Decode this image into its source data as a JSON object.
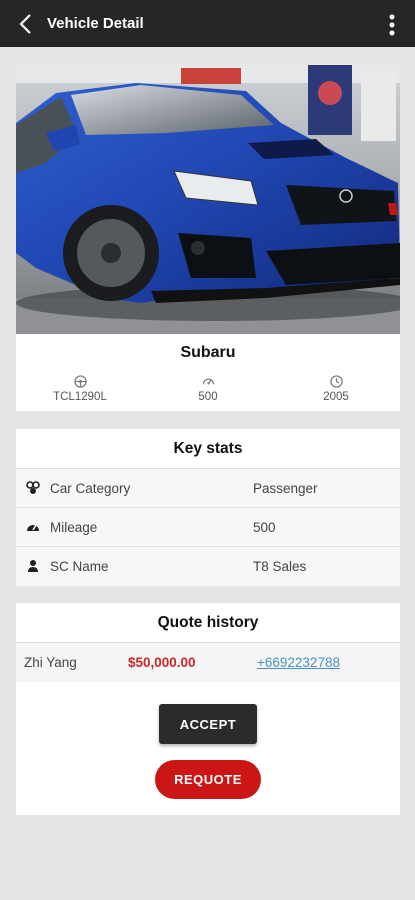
{
  "appbar": {
    "title": "Vehicle Detail"
  },
  "hero": {
    "image": "blue-subaru-photo"
  },
  "vehicle": {
    "name": "Subaru",
    "plate": "TCL1290L",
    "mileage": "500",
    "year": "2005"
  },
  "key_stats": {
    "title": "Key stats",
    "rows": [
      {
        "icon": "car-category-icon",
        "label": "Car Category",
        "value": "Passenger"
      },
      {
        "icon": "speedometer-icon",
        "label": "Mileage",
        "value": "500"
      },
      {
        "icon": "person-icon",
        "label": "SC Name",
        "value": "T8 Sales"
      }
    ]
  },
  "quote_history": {
    "title": "Quote history",
    "rows": [
      {
        "name": "Zhi Yang",
        "amount": "$50,000.00",
        "phone": "+6692232788"
      }
    ],
    "accept_label": "ACCEPT",
    "requote_label": "REQUOTE"
  },
  "colors": {
    "appbar": "#262626",
    "accent_red": "#cc1616",
    "amount_red": "#c62828",
    "link_blue": "#4a90c2"
  }
}
